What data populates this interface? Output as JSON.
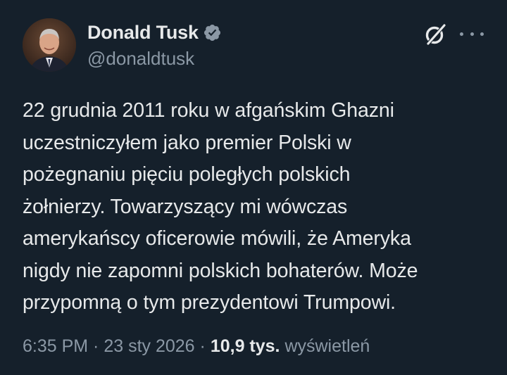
{
  "author": {
    "display_name": "Donald Tusk",
    "handle": "@donaldtusk",
    "verified_icon": "verified-badge-icon",
    "verified_color": "#8b98a5"
  },
  "actions": {
    "grok_icon": "grok-icon",
    "more_icon": "more-horizontal-icon"
  },
  "tweet": {
    "text": "22 grudnia 2011 roku w afgańskim Ghazni\nuczestniczyłem jako premier Polski w\npożegnaniu pięciu poległych polskich\nżołnierzy. Towarzyszący mi wówczas\namerykańscy oficerowie mówili, że Ameryka\nnigdy nie zapomni polskich bohaterów. Może\nprzypomną o tym prezydentowi Trumpowi."
  },
  "meta": {
    "time": "6:35 PM",
    "separator_1": " · ",
    "date": "23 sty 2026",
    "separator_2": " · ",
    "views_count": "10,9 tys.",
    "views_label": "wyświetleń"
  },
  "colors": {
    "background": "#15202b",
    "text_primary": "#e7e9ea",
    "text_secondary": "#8b98a5"
  }
}
